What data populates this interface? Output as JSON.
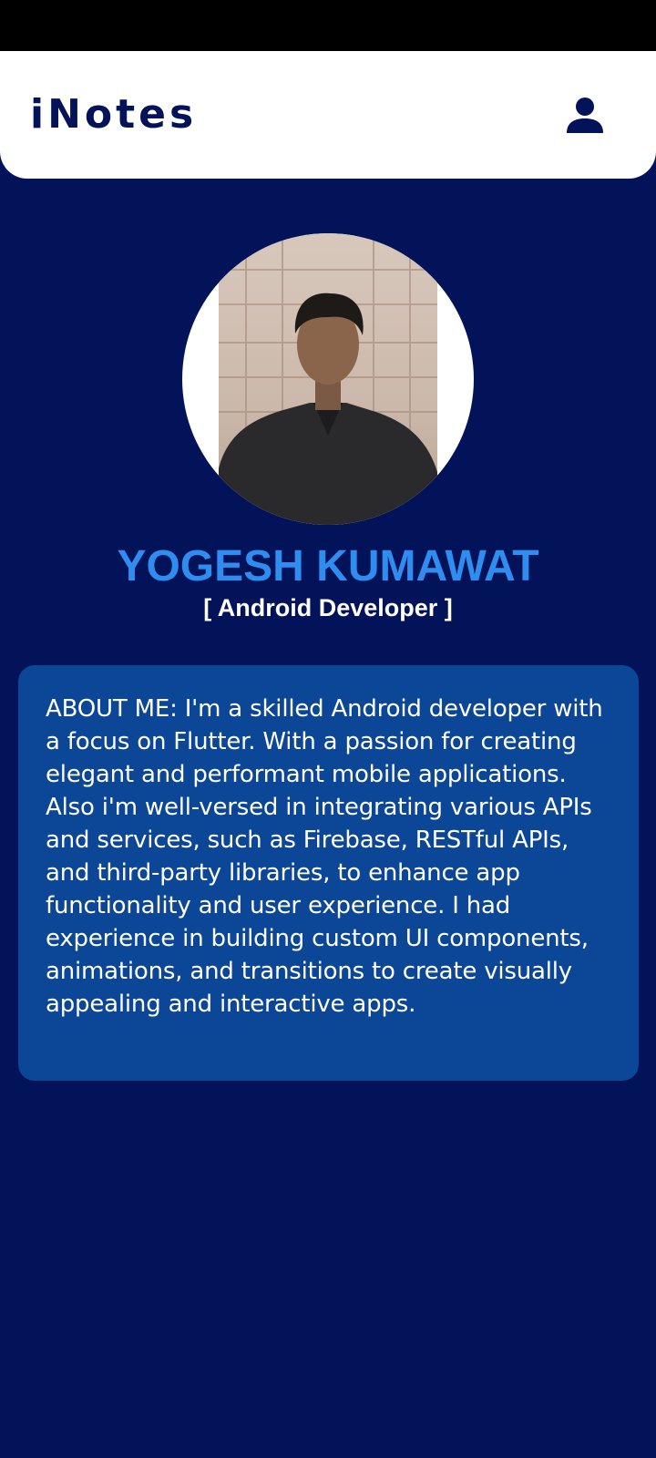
{
  "app": {
    "title": "iNotes",
    "profile_icon": "person-icon"
  },
  "profile": {
    "avatar": "profile-photo",
    "name": "YOGESH KUMAWAT",
    "role": "[ Android Developer ]"
  },
  "about": {
    "text": "ABOUT ME:  I'm a skilled Android developer with a focus on Flutter. With a passion for creating elegant and performant mobile applications.\nAlso i'm well-versed in integrating various APIs and services, such as Firebase, RESTful APIs, and third-party libraries, to enhance app functionality and user experience. I had experience in building custom UI components, animations, and transitions to create visually appealing and interactive apps."
  },
  "colors": {
    "background": "#02135a",
    "app_bar": "#ffffff",
    "name_accent": "#2f8df0",
    "card": "#0c4696"
  }
}
